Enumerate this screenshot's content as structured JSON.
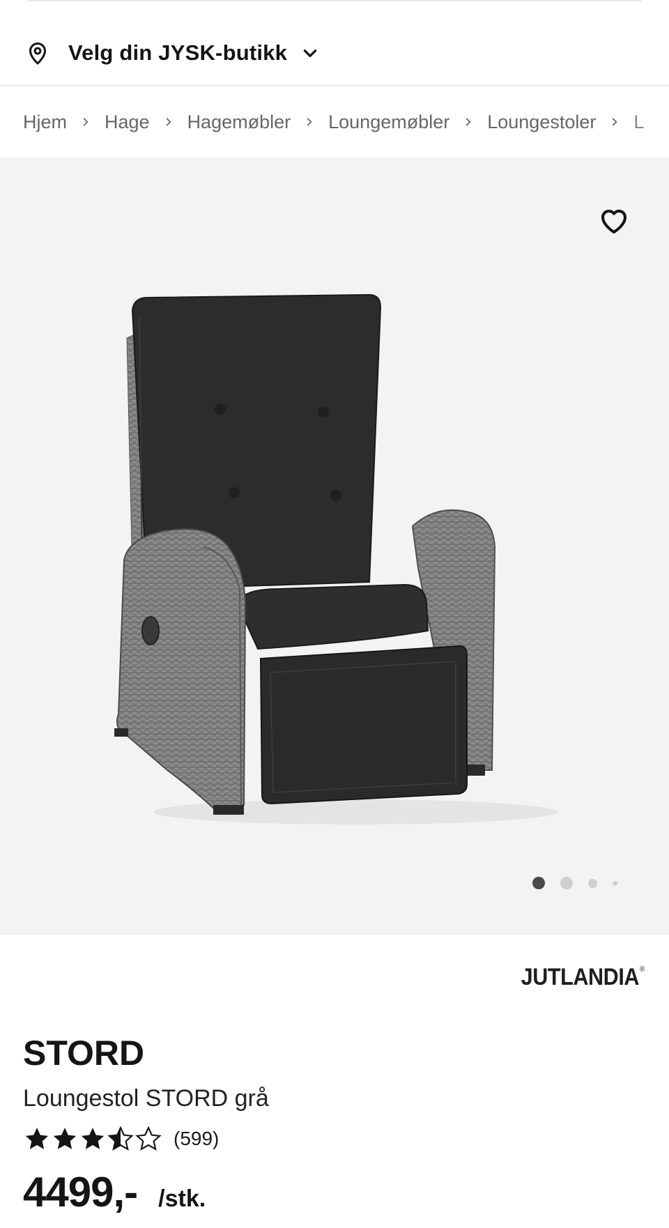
{
  "store_selector": {
    "label": "Velg din JYSK-butikk"
  },
  "breadcrumb": [
    {
      "label": "Hjem"
    },
    {
      "label": "Hage"
    },
    {
      "label": "Hagemøbler"
    },
    {
      "label": "Loungemøbler"
    },
    {
      "label": "Loungestoler"
    },
    {
      "label": "L"
    }
  ],
  "gallery": {
    "slide_count": 4,
    "active_slide": 1
  },
  "product": {
    "brand": "JUTLANDIA",
    "brand_mark": "®",
    "name": "STORD",
    "description": "Loungestol STORD grå",
    "rating": 3.5,
    "rating_max": 5,
    "reviews": "(599)",
    "price": "4499,-",
    "unit": "/stk."
  },
  "colors": {
    "text": "#151515",
    "gallery_bg": "#f3f3f3",
    "dot_active": "#4a4a4a",
    "dot_inactive": "#cfcfcf"
  }
}
